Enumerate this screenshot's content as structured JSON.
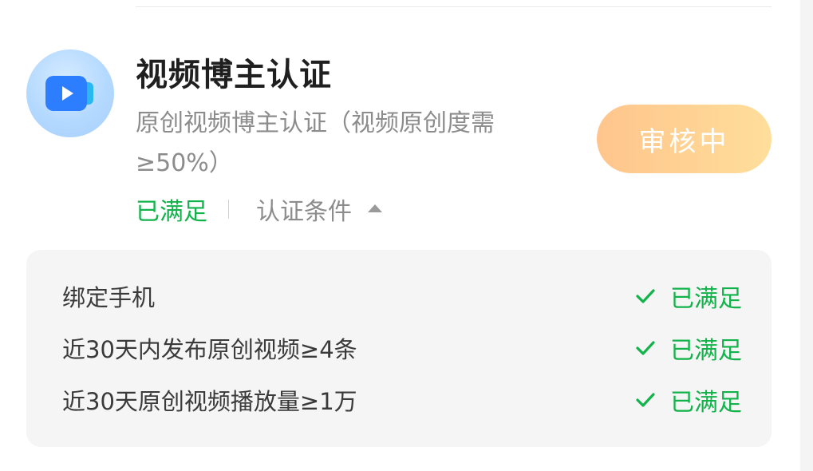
{
  "cert": {
    "title": "视频博主认证",
    "description": "原创视频博主认证（视频原创度需≥50%）",
    "status_text": "已满足",
    "conditions_toggle_label": "认证条件",
    "button_label": "审核中",
    "icon": "video-camera-icon"
  },
  "conditions": [
    {
      "label": "绑定手机",
      "status": "已满足"
    },
    {
      "label": "近30天内发布原创视频≥4条",
      "status": "已满足"
    },
    {
      "label": "近30天原创视频播放量≥1万",
      "status": "已满足"
    }
  ],
  "colors": {
    "accent_green": "#12b34a",
    "button_gradient_start": "#ffc58c",
    "button_gradient_end": "#ffde9b",
    "icon_blue": "#2d7dff"
  }
}
